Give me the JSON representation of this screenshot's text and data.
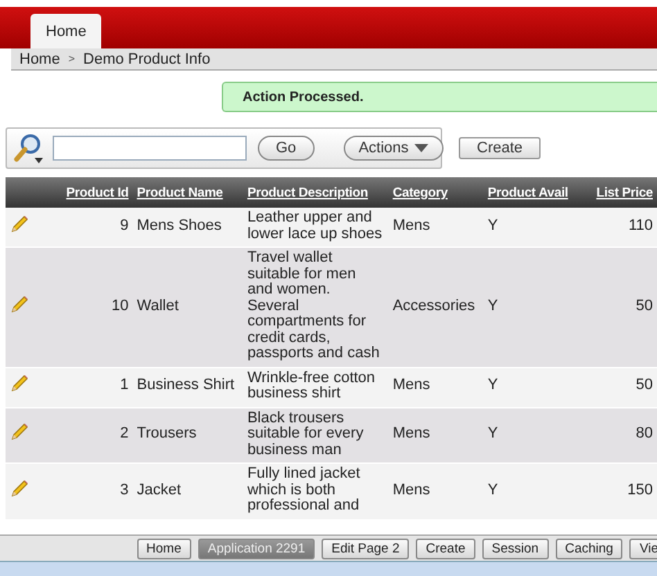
{
  "tabs": [
    {
      "label": "Home",
      "selected": true
    }
  ],
  "breadcrumb": [
    {
      "label": "Home"
    },
    {
      "label": "Demo Product Info"
    }
  ],
  "breadcrumb_separator": ">",
  "message": "Action Processed.",
  "search": {
    "go": "Go",
    "actions": "Actions",
    "create": "Create"
  },
  "table": {
    "columns": [
      "Product Id",
      "Product Name",
      "Product Description",
      "Category",
      "Product Avail",
      "List Price"
    ],
    "rows": [
      {
        "id": "9",
        "name": "Mens Shoes",
        "description": "Leather upper and lower lace up shoes",
        "category": "Mens",
        "avail": "Y",
        "price": "110"
      },
      {
        "id": "10",
        "name": "Wallet",
        "description": "Travel wallet suitable for men and women. Several compartments for credit cards, passports and cash",
        "category": "Accessories",
        "avail": "Y",
        "price": "50"
      },
      {
        "id": "1",
        "name": "Business Shirt",
        "description": "Wrinkle-free cotton business shirt",
        "category": "Mens",
        "avail": "Y",
        "price": "50"
      },
      {
        "id": "2",
        "name": "Trousers",
        "description": "Black trousers suitable for every business man",
        "category": "Mens",
        "avail": "Y",
        "price": "80"
      },
      {
        "id": "3",
        "name": "Jacket",
        "description": "Fully lined jacket which is both professional and",
        "category": "Mens",
        "avail": "Y",
        "price": "150"
      }
    ]
  },
  "developer_toolbar": [
    {
      "label": "Home",
      "pressed": false
    },
    {
      "label": "Application 2291",
      "pressed": true
    },
    {
      "label": "Edit Page 2",
      "pressed": false
    },
    {
      "label": "Create",
      "pressed": false
    },
    {
      "label": "Session",
      "pressed": false
    },
    {
      "label": "Caching",
      "pressed": false
    },
    {
      "label": "Vie",
      "pressed": false
    }
  ]
}
